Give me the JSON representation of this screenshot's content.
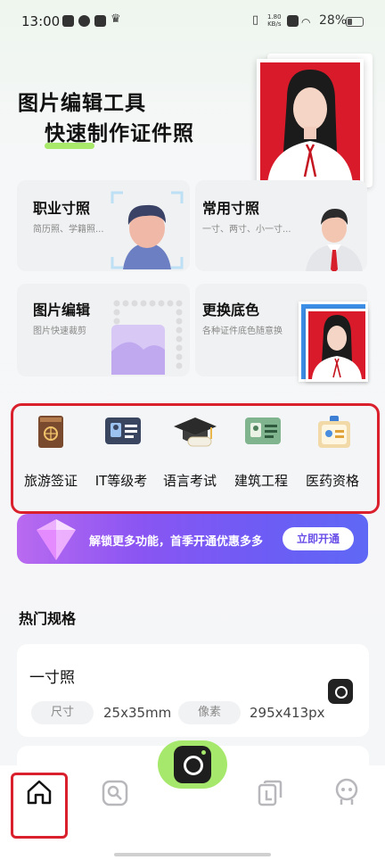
{
  "status_bar": {
    "time": "13:00",
    "net_speed": "1.80",
    "net_unit": "KB/s",
    "battery": "28%"
  },
  "hero": {
    "line1": "图片编辑工具",
    "line2": "快速制作证件照"
  },
  "cards": {
    "job": {
      "title": "职业寸照",
      "sub": "简历照、学籍照..."
    },
    "common": {
      "title": "常用寸照",
      "sub": "一寸、两寸、小一寸..."
    },
    "edit": {
      "title": "图片编辑",
      "sub": "图片快速裁剪"
    },
    "bg": {
      "title": "更换底色",
      "sub": "各种证件底色随意换"
    }
  },
  "features": [
    {
      "label": "旅游签证",
      "icon": "passport-icon"
    },
    {
      "label": "IT等级考",
      "icon": "id-card-icon"
    },
    {
      "label": "语言考试",
      "icon": "graduation-cap-icon"
    },
    {
      "label": "建筑工程",
      "icon": "license-card-icon"
    },
    {
      "label": "医药资格",
      "icon": "badge-icon"
    }
  ],
  "promo": {
    "text": "解锁更多功能，首季开通优惠多多",
    "button": "立即开通"
  },
  "hot": {
    "title": "热门规格",
    "spec": {
      "name": "一寸照",
      "size_label": "尺寸",
      "size_value": "25x35mm",
      "pixel_label": "像素",
      "pixel_value": "295x413px"
    }
  },
  "nav": {
    "items": [
      "home-icon",
      "edit-icon",
      "camera-icon",
      "copy-icon",
      "profile-icon"
    ]
  },
  "colors": {
    "accent_green": "#a6e86b",
    "highlight_red": "#d9202c",
    "promo_purple": "#7b57f3",
    "photo_red": "#d91a2a"
  }
}
